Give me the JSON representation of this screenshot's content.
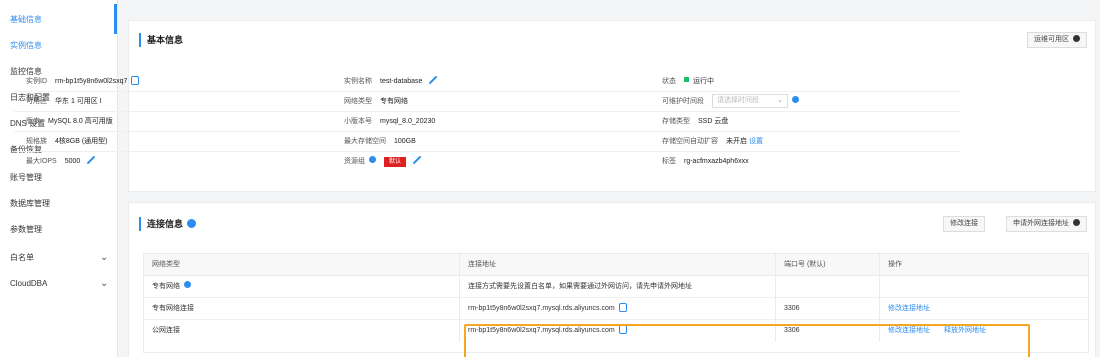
{
  "sidebar": {
    "items": [
      {
        "label": "基础信息",
        "active": true
      },
      {
        "label": "实例信息",
        "active": true
      },
      {
        "label": "监控信息"
      },
      {
        "label": "日志和配置"
      },
      {
        "label": "DNS 设置"
      },
      {
        "label": "备份恢复"
      },
      {
        "label": "账号管理"
      },
      {
        "label": "数据库管理"
      },
      {
        "label": "参数管理"
      },
      {
        "label": "白名单",
        "expandable": true
      },
      {
        "label": "CloudDBA",
        "expandable": true
      }
    ]
  },
  "basic_card": {
    "title": "基本信息",
    "action_button": "运维可用区",
    "rows": [
      [
        {
          "label": "实例ID",
          "value": "rm-bp1t5y8n6w0l2sxq7",
          "icon": "copy-icon"
        },
        {
          "label": "实例名称",
          "value": "test-database",
          "icon": "edit-icon"
        },
        {
          "label": "状态",
          "value": "运行中",
          "status_color": "#19be6b"
        }
      ],
      [
        {
          "label": "可用区",
          "value": "华东 1 可用区 I"
        },
        {
          "label": "网络类型",
          "value": "专有网络"
        },
        {
          "label": "可维护时间段",
          "select_placeholder": "请选择时间段",
          "icon": "info-dot"
        }
      ],
      [
        {
          "label": "版本",
          "value": "MySQL 8.0 高可用版"
        },
        {
          "label": "小版本号",
          "value": "mysql_8.0_20230"
        },
        {
          "label": "存储类型",
          "value": "SSD 云盘"
        }
      ],
      [
        {
          "label": "规格族",
          "value": "4核8GB (通用型)"
        },
        {
          "label": "最大存储空间",
          "value": "100GB"
        },
        {
          "label": "存储空间自动扩容",
          "value": "未开启",
          "link": "设置"
        }
      ],
      [
        {
          "label": "最大IOPS",
          "value": "5000",
          "icon": "edit-icon"
        },
        {
          "label": "资源组",
          "value": "默认",
          "badge": "默认",
          "badge_color": "#e02020",
          "icon": "edit-icon"
        },
        {
          "label": "标签",
          "value": "rg-acfmxazb4ph6xxx"
        }
      ]
    ]
  },
  "connection_card": {
    "title": "连接信息",
    "buttons": [
      "修改连接",
      "申请外网连接地址"
    ],
    "table": {
      "headers": [
        "网络类型",
        "连接地址",
        "端口号 (默认)",
        "操作"
      ],
      "rows": [
        {
          "cells": [
            "专有网络",
            "连接方式需要先设置白名单，如果需要通过外网访问，请先申请外网地址",
            "",
            ""
          ],
          "icon": "info-dot"
        },
        {
          "cells": [
            "专有网络连接",
            "rm-bp1t5y8n6w0l2sxq7.mysql.rds.aliyuncs.com",
            "3306",
            "修改连接地址"
          ]
        },
        {
          "cells": [
            "公网连接",
            "rm-bp1t5y8n6w0l2sxq7.mysql.rds.aliyuncs.com",
            "3306",
            "修改连接地址",
            "释放外网地址"
          ],
          "highlight": true
        }
      ]
    }
  },
  "colors": {
    "accent": "#2d8cf0",
    "highlight": "#f5a623",
    "status_green": "#19be6b",
    "badge_red": "#e02020"
  }
}
